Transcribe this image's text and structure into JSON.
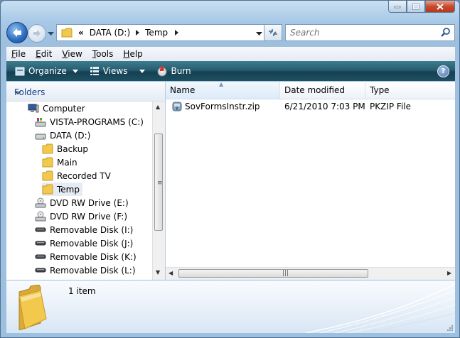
{
  "window": {
    "caption_buttons": [
      "minimize-icon",
      "maximize-icon",
      "close-icon"
    ]
  },
  "address_bar": {
    "overflow": "«",
    "segments": [
      "DATA (D:)",
      "Temp"
    ]
  },
  "search": {
    "placeholder": "Search"
  },
  "menu": {
    "items": [
      {
        "label": "File",
        "key": "F",
        "rest": "ile"
      },
      {
        "label": "Edit",
        "key": "E",
        "rest": "dit"
      },
      {
        "label": "View",
        "key": "V",
        "rest": "iew"
      },
      {
        "label": "Tools",
        "key": "T",
        "rest": "ools"
      },
      {
        "label": "Help",
        "key": "H",
        "rest": "elp"
      }
    ]
  },
  "toolbar": {
    "organize": "Organize",
    "views": "Views",
    "burn": "Burn"
  },
  "nav": {
    "header": "Folders",
    "items": [
      {
        "label": "Computer",
        "icon": "computer-icon"
      },
      {
        "label": "VISTA-PROGRAMS (C:)",
        "icon": "system-drive-icon"
      },
      {
        "label": "DATA (D:)",
        "icon": "hard-drive-icon"
      },
      {
        "label": "Backup",
        "icon": "folder-icon"
      },
      {
        "label": "Main",
        "icon": "folder-icon"
      },
      {
        "label": "Recorded TV",
        "icon": "folder-icon"
      },
      {
        "label": "Temp",
        "icon": "folder-icon",
        "selected": true
      },
      {
        "label": "DVD RW Drive (E:)",
        "icon": "dvd-drive-icon"
      },
      {
        "label": "DVD RW Drive (F:)",
        "icon": "dvd-drive-icon"
      },
      {
        "label": "Removable Disk (I:)",
        "icon": "removable-disk-icon"
      },
      {
        "label": "Removable Disk (J:)",
        "icon": "removable-disk-icon"
      },
      {
        "label": "Removable Disk (K:)",
        "icon": "removable-disk-icon"
      },
      {
        "label": "Removable Disk (L:)",
        "icon": "removable-disk-icon"
      }
    ]
  },
  "files": {
    "columns": [
      "Name",
      "Date modified",
      "Type"
    ],
    "sorted_column": "Name",
    "rows": [
      {
        "name": "SovFormsInstr.zip",
        "date": "6/21/2010 7:03 PM",
        "type": "PKZIP File",
        "icon": "zip-file-icon"
      }
    ]
  },
  "details": {
    "count": "1 item"
  },
  "colors": {
    "toolbar": "#275d70",
    "nav_header_text": "#1a3e8a",
    "folder": "#f2c94c"
  }
}
